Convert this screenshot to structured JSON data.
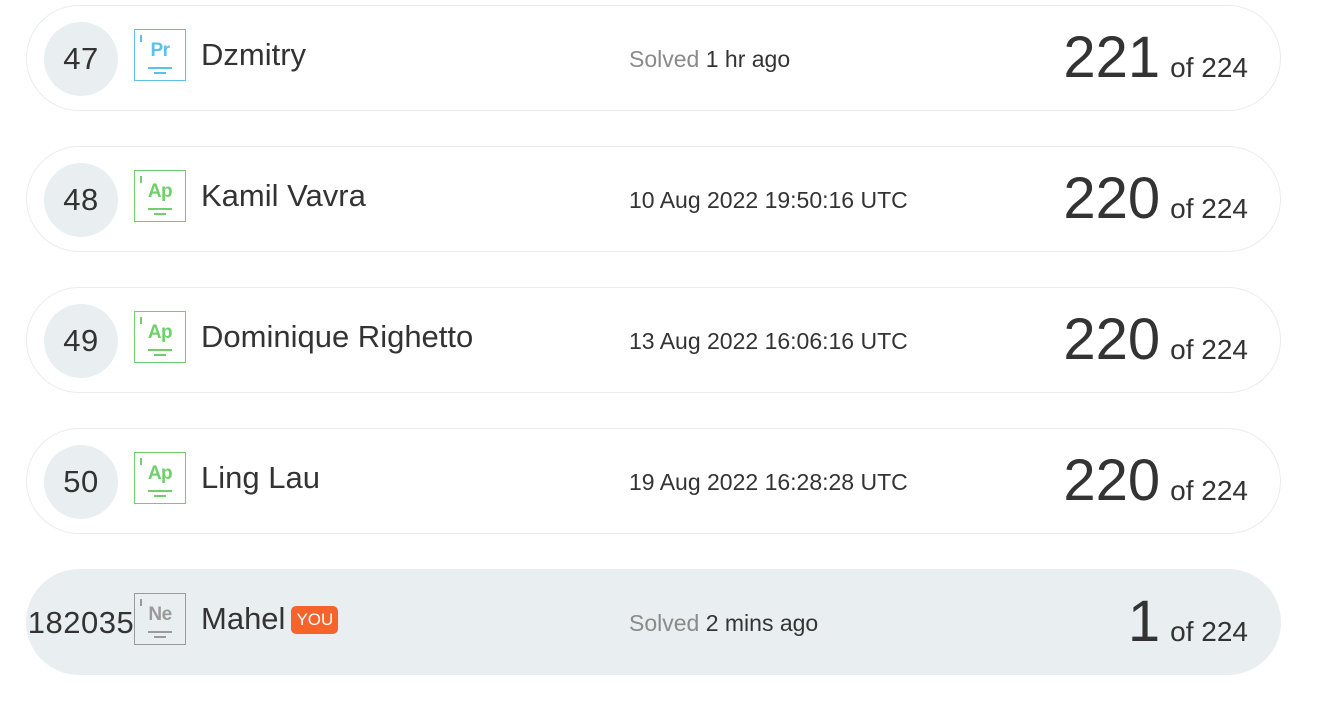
{
  "leaderboard": {
    "rows": [
      {
        "rank": "47",
        "badge_symbol": "Pr",
        "badge_color": "#5bc0eb",
        "name": "Dzmitry",
        "time_prefix": "Solved",
        "time_value": "1 hr ago",
        "score": "221",
        "of_total": "of 224"
      },
      {
        "rank": "48",
        "badge_symbol": "Ap",
        "badge_color": "#6fcf6a",
        "name": "Kamil Vavra",
        "time_prefix": "",
        "time_value": "10 Aug 2022 19:50:16 UTC",
        "score": "220",
        "of_total": "of 224"
      },
      {
        "rank": "49",
        "badge_symbol": "Ap",
        "badge_color": "#6fcf6a",
        "name": "Dominique Righetto",
        "time_prefix": "",
        "time_value": "13 Aug 2022 16:06:16 UTC",
        "score": "220",
        "of_total": "of 224"
      },
      {
        "rank": "50",
        "badge_symbol": "Ap",
        "badge_color": "#6fcf6a",
        "name": "Ling Lau",
        "time_prefix": "",
        "time_value": "19 Aug 2022 16:28:28 UTC",
        "score": "220",
        "of_total": "of 224"
      }
    ],
    "current_user": {
      "rank": "182035",
      "badge_symbol": "Ne",
      "badge_color": "#9a9a9a",
      "name": "Mahel",
      "you_label": "YOU",
      "you_color": "#f6632b",
      "time_prefix": "Solved",
      "time_value": "2 mins ago",
      "score": "1",
      "of_total": "of 224"
    }
  }
}
